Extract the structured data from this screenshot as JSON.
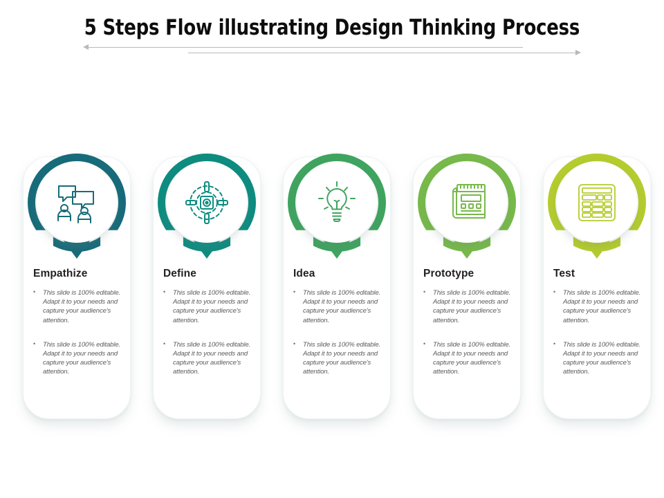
{
  "slide": {
    "title": "5 Steps Flow illustrating Design Thinking Process",
    "background_color": "#ffffff"
  },
  "decor": {
    "arrow_left_name": "left-arrow",
    "arrow_right_name": "right-arrow",
    "arrow_color": "#b9b9b9"
  },
  "bullet_text": "This slide is 100% editable. Adapt it to your needs and capture your audience's attention.",
  "steps": [
    {
      "index": "1",
      "heading": "Empathize",
      "icon": "people-speech-bubbles-icon",
      "color": "#176b7a",
      "bullets": [
        "This slide is 100% editable. Adapt it to your needs and capture your audience's attention.",
        "This slide is 100% editable. Adapt it to your needs and capture your audience's attention."
      ]
    },
    {
      "index": "2",
      "heading": "Define",
      "icon": "target-crosshair-icon",
      "color": "#0e8c80",
      "bullets": [
        "This slide is 100% editable. Adapt it to your needs and capture your audience's attention.",
        "This slide is 100% editable. Adapt it to your needs and capture your audience's attention."
      ]
    },
    {
      "index": "3",
      "heading": "Idea",
      "icon": "lightbulb-icon",
      "color": "#3fa45f",
      "bullets": [
        "This slide is 100% editable. Adapt it to your needs and capture your audience's attention.",
        "This slide is 100% editable. Adapt it to your needs and capture your audience's attention."
      ]
    },
    {
      "index": "4",
      "heading": "Prototype",
      "icon": "blueprint-wireframe-icon",
      "color": "#77b94a",
      "bullets": [
        "This slide is 100% editable. Adapt it to your needs and capture your audience's attention.",
        "This slide is 100% editable. Adapt it to your needs and capture your audience's attention."
      ]
    },
    {
      "index": "5",
      "heading": "Test",
      "icon": "table-checklist-icon",
      "color": "#b5cc2e",
      "bullets": [
        "This slide is 100% editable. Adapt it to your needs and capture your audience's attention.",
        "This slide is 100% editable. Adapt it to your needs and capture your audience's attention."
      ]
    }
  ]
}
